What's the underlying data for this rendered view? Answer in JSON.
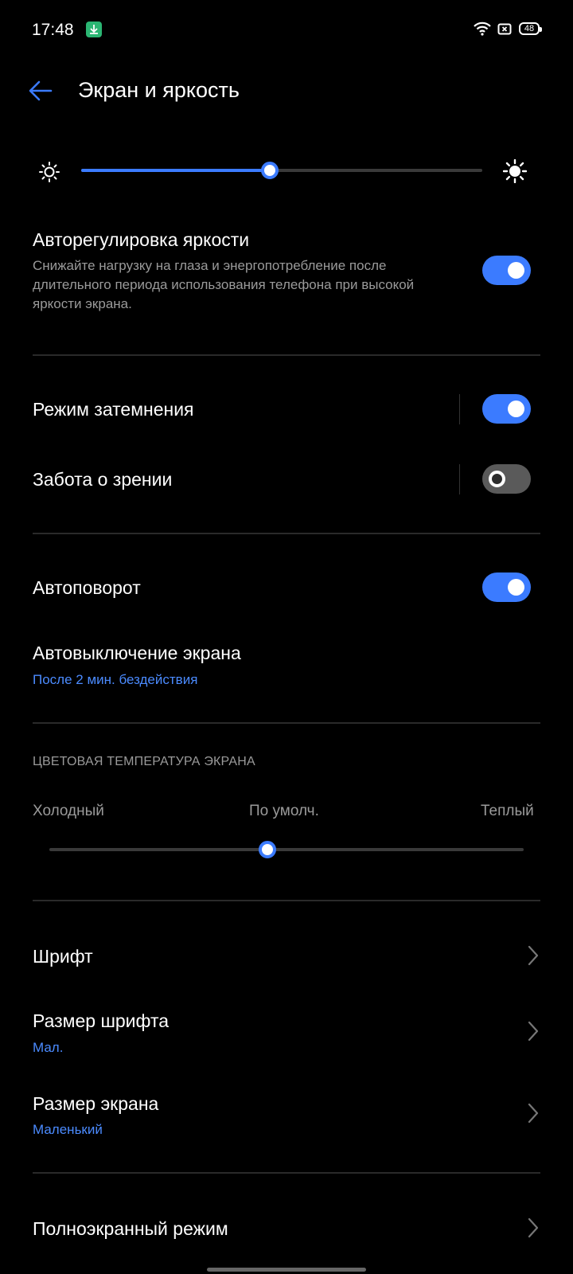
{
  "status": {
    "time": "17:48",
    "battery": "48"
  },
  "header": {
    "title": "Экран и яркость"
  },
  "brightness": {
    "level": 0.47
  },
  "auto_brightness": {
    "title": "Авторегулировка яркости",
    "description": "Снижайте нагрузку на глаза и энергопотребление после длительного периода использования телефона при высокой яркости экрана.",
    "enabled": true
  },
  "dark_mode": {
    "title": "Режим затемнения",
    "enabled": true
  },
  "eye_care": {
    "title": "Забота о зрении",
    "enabled": false
  },
  "auto_rotate": {
    "title": "Автоповорот",
    "enabled": true
  },
  "screen_timeout": {
    "title": "Автовыключение экрана",
    "value": "После 2 мин. бездействия"
  },
  "color_temperature": {
    "section_label": "ЦВЕТОВАЯ ТЕМПЕРАТУРА ЭКРАНА",
    "cold_label": "Холодный",
    "default_label": "По умолч.",
    "warm_label": "Теплый",
    "level": 0.46
  },
  "font": {
    "title": "Шрифт"
  },
  "font_size": {
    "title": "Размер шрифта",
    "value": "Мал."
  },
  "screen_size": {
    "title": "Размер экрана",
    "value": "Маленький"
  },
  "fullscreen": {
    "title": "Полноэкранный режим"
  },
  "colors": {
    "accent": "#3b7bff",
    "background": "#000000"
  }
}
